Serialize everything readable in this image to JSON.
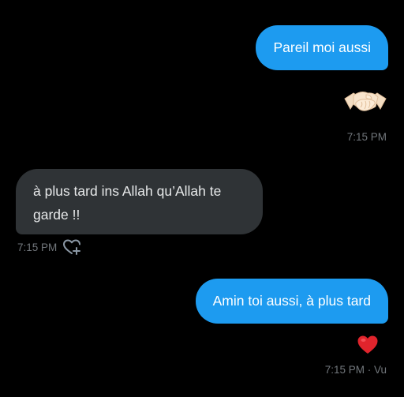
{
  "conversation": {
    "messages": [
      {
        "direction": "outgoing",
        "text": "Pareil moi aussi"
      },
      {
        "direction": "outgoing",
        "emoji": "handshake-emoji",
        "timestamp": "7:15 PM"
      },
      {
        "direction": "incoming",
        "text": "à plus tard ins Allah qu’Allah te garde !!",
        "timestamp": "7:15 PM"
      },
      {
        "direction": "outgoing",
        "text": "Amin toi aussi, à plus tard",
        "reaction": "red-heart",
        "timestamp": "7:15 PM · Vu"
      }
    ]
  },
  "colors": {
    "background": "#000000",
    "outgoing_bubble": "#1d9bf0",
    "incoming_bubble": "#2f3336",
    "timestamp": "#71767b",
    "heart": "#e0242c"
  },
  "icons": {
    "react": "add-reaction-heart-icon",
    "reaction": "red-heart-icon",
    "emoji": "handshake-icon"
  }
}
